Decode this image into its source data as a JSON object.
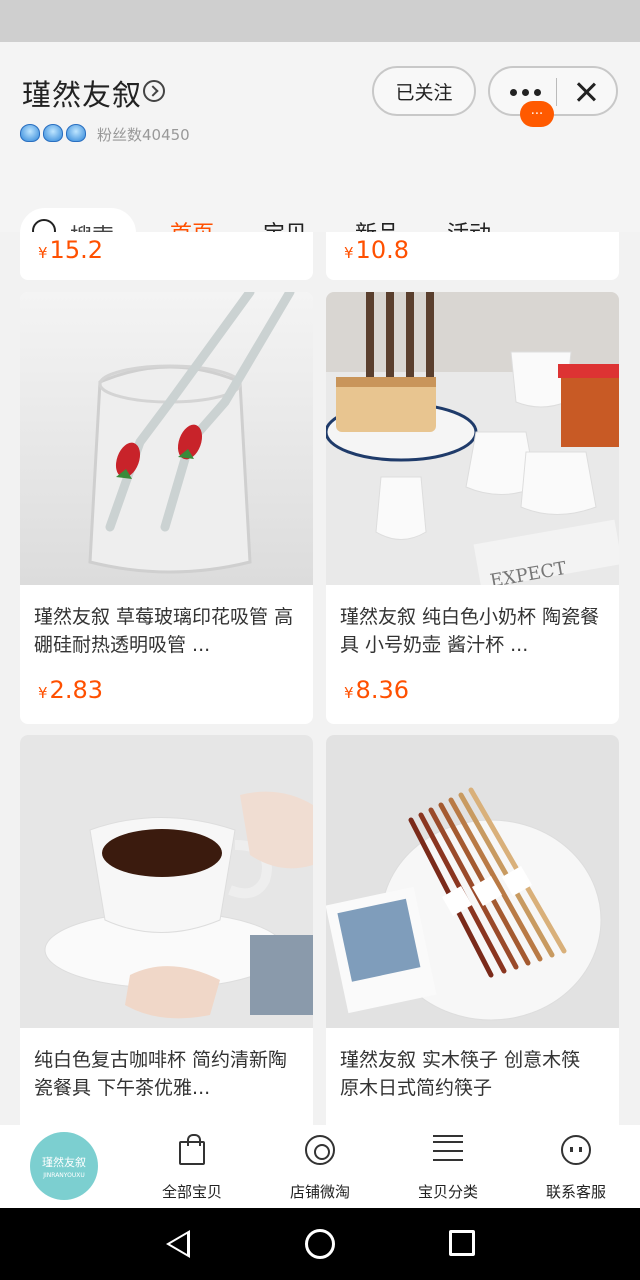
{
  "shop": {
    "name": "瑾然友叙",
    "fans": "粉丝数40450",
    "follow_label": "已关注",
    "badge": "···"
  },
  "search": {
    "label": "搜索"
  },
  "tabs": [
    {
      "label": "首页",
      "active": true
    },
    {
      "label": "宝贝",
      "active": false
    },
    {
      "label": "新品",
      "active": false
    },
    {
      "label": "活动",
      "active": false
    }
  ],
  "currency_symbol": "¥",
  "products_partial": [
    {
      "price": "15.2"
    },
    {
      "price": "10.8"
    }
  ],
  "products": [
    {
      "title": "瑾然友叙 草莓玻璃印花吸管 高硼硅耐热透明吸管 ...",
      "price": "2.83",
      "image": "glass-straws-image"
    },
    {
      "title": "瑾然友叙 纯白色小奶杯 陶瓷餐具 小号奶壶 酱汁杯 ...",
      "price": "8.36",
      "image": "milk-jug-image"
    },
    {
      "title": "纯白色复古咖啡杯 简约清新陶瓷餐具 下午茶优雅...",
      "price": "",
      "image": "coffee-cup-image"
    },
    {
      "title": "瑾然友叙 实木筷子 创意木筷 原木日式简约筷子",
      "price": "",
      "image": "chopsticks-image"
    }
  ],
  "bottom_nav": {
    "logo_text": "瑾然友叙",
    "logo_sub": "JINRANYOUXU",
    "items": [
      {
        "label": "全部宝贝",
        "icon": "bag-icon"
      },
      {
        "label": "店铺微淘",
        "icon": "broadcast-icon"
      },
      {
        "label": "宝贝分类",
        "icon": "list-icon"
      },
      {
        "label": "联系客服",
        "icon": "service-icon"
      }
    ]
  },
  "colors": {
    "accent": "#ff5000",
    "badge": "#ff5a00"
  }
}
